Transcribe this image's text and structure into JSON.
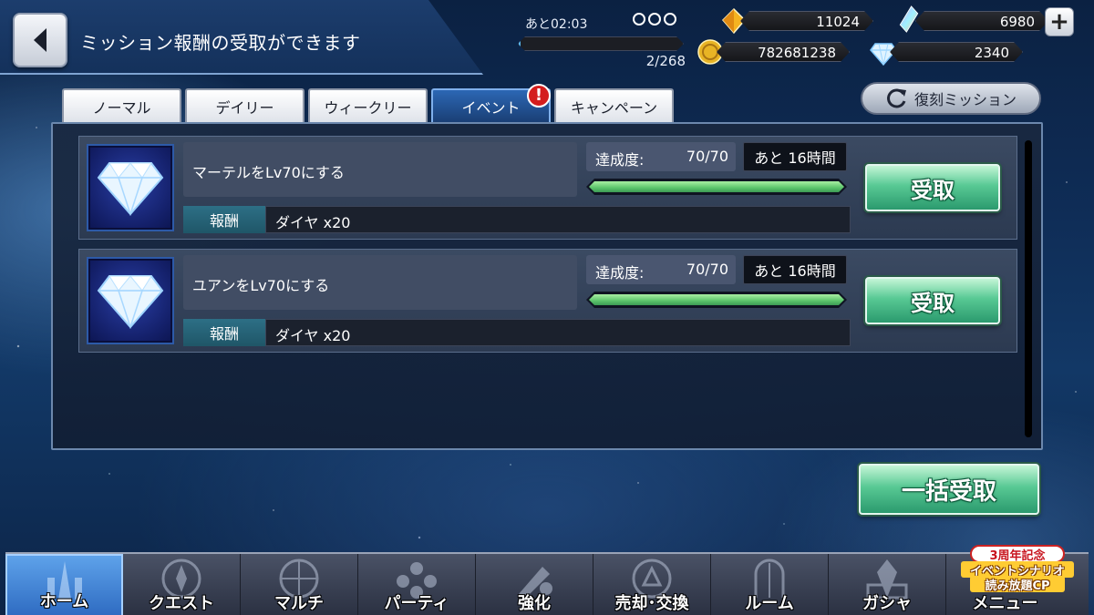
{
  "header": {
    "title": "ミッション報酬の受取ができます",
    "stamina": {
      "timer": "あと02:03",
      "count": "2/268",
      "fill_fraction": 0.01
    },
    "currencies": {
      "gold_crystal": "11024",
      "rainbow_crystal": "6980",
      "coins": "782681238",
      "diamonds": "2340"
    }
  },
  "tabs": [
    {
      "label": "ノーマル",
      "active": false
    },
    {
      "label": "デイリー",
      "active": false
    },
    {
      "label": "ウィークリー",
      "active": false
    },
    {
      "label": "イベント",
      "active": true,
      "badge": "!"
    },
    {
      "label": "キャンペーン",
      "active": false
    }
  ],
  "revival_button": "復刻ミッション",
  "missions": [
    {
      "description": "マーテルをLv70にする",
      "progress_label": "達成度:",
      "progress_value": "70/70",
      "progress_fraction": 1.0,
      "remaining": "あと 16時間",
      "reward_label": "報酬",
      "reward": "ダイヤ x20",
      "claim_label": "受取",
      "icon": "diamond-icon"
    },
    {
      "description": "ユアンをLv70にする",
      "progress_label": "達成度:",
      "progress_value": "70/70",
      "progress_fraction": 1.0,
      "remaining": "あと 16時間",
      "reward_label": "報酬",
      "reward": "ダイヤ x20",
      "claim_label": "受取",
      "icon": "diamond-icon"
    }
  ],
  "bulk_claim": "一括受取",
  "nav": [
    {
      "label": "ホーム",
      "active": true,
      "icon": "home-icon"
    },
    {
      "label": "クエスト",
      "active": false,
      "icon": "quest-icon"
    },
    {
      "label": "マルチ",
      "active": false,
      "icon": "multi-icon"
    },
    {
      "label": "パーティ",
      "active": false,
      "icon": "party-icon"
    },
    {
      "label": "強化",
      "active": false,
      "icon": "enhance-icon"
    },
    {
      "label": "売却･交換",
      "active": false,
      "icon": "trade-icon"
    },
    {
      "label": "ルーム",
      "active": false,
      "icon": "room-icon"
    },
    {
      "label": "ガシャ",
      "active": false,
      "icon": "gacha-icon"
    },
    {
      "label": "メニュー",
      "active": false,
      "icon": "menu-icon"
    }
  ],
  "promo": {
    "line1": "3周年記念",
    "line2": "イベントシナリオ",
    "line3": "読み放題CP"
  },
  "colors": {
    "active_tab": "#2c67b4",
    "claim_green": "#58c994",
    "badge_red": "#d41d1d"
  }
}
